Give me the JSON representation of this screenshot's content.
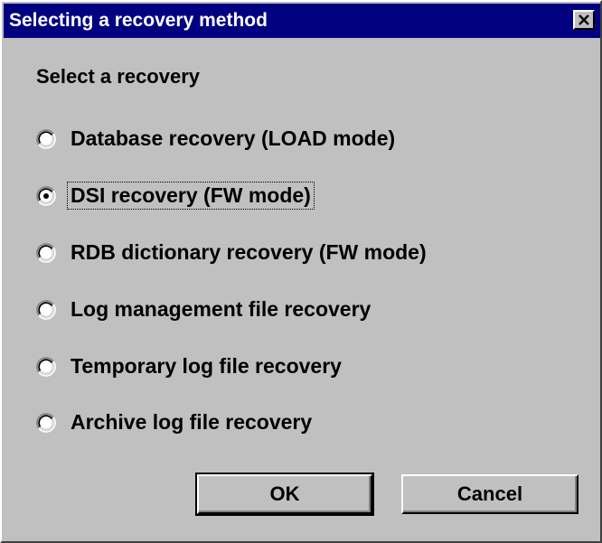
{
  "window": {
    "title": "Selecting a recovery method",
    "close_icon": "close-icon"
  },
  "group_label": "Select a recovery",
  "options": [
    {
      "label": "Database recovery (LOAD mode)",
      "selected": false
    },
    {
      "label": "DSI recovery (FW mode)",
      "selected": true
    },
    {
      "label": "RDB dictionary recovery (FW mode)",
      "selected": false
    },
    {
      "label": "Log management file recovery",
      "selected": false
    },
    {
      "label": "Temporary log file recovery",
      "selected": false
    },
    {
      "label": "Archive log file recovery",
      "selected": false
    }
  ],
  "buttons": {
    "ok_label": "OK",
    "cancel_label": "Cancel"
  },
  "colors": {
    "title_bar": "#000080",
    "face": "#c0c0c0"
  }
}
